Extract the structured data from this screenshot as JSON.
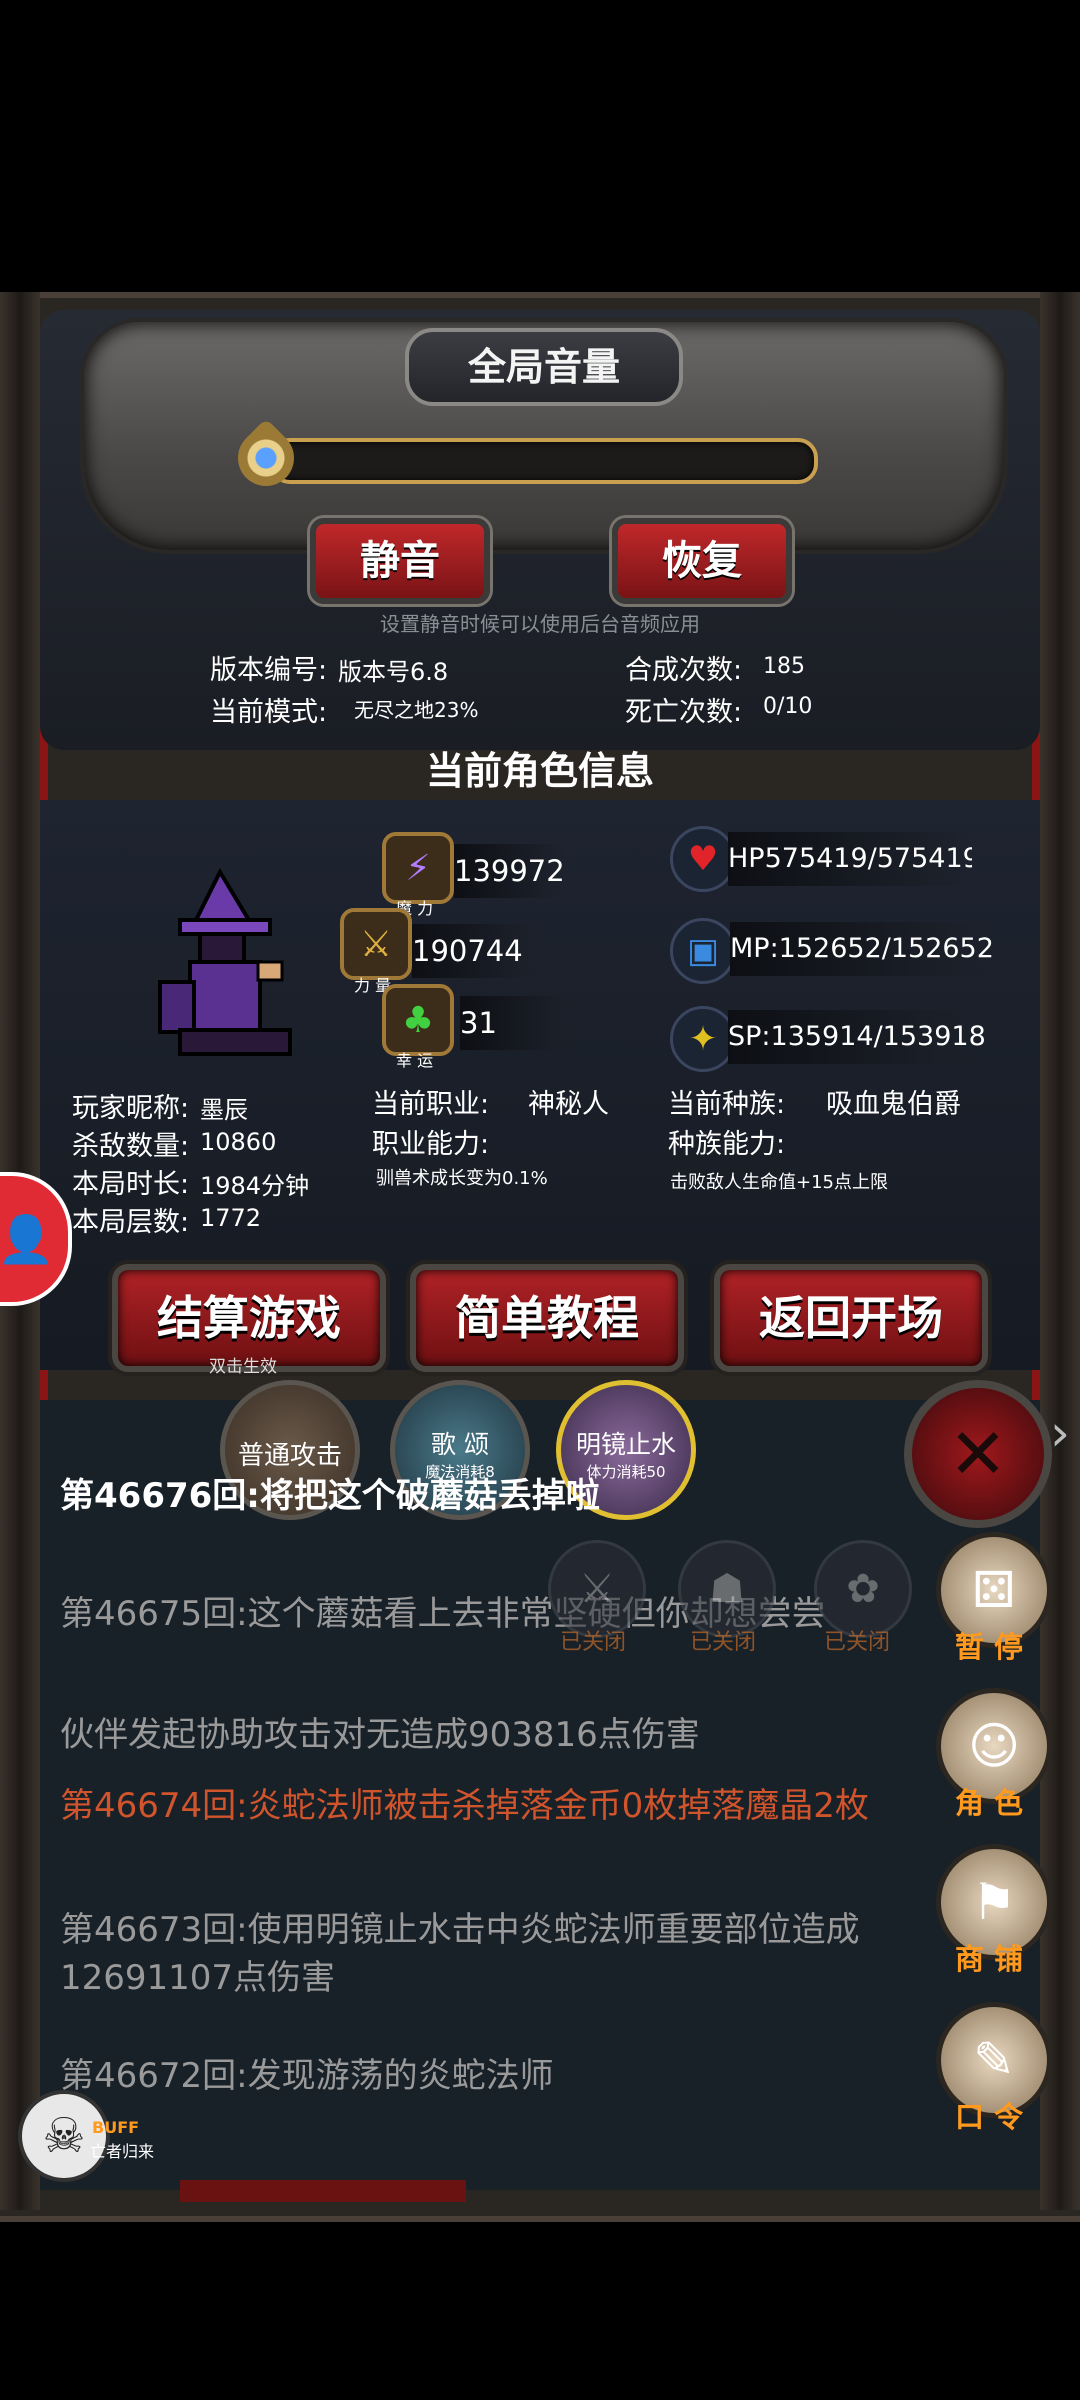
{
  "settings": {
    "title": "全局音量",
    "mute_label": "静音",
    "restore_label": "恢复",
    "hint": "设置静音时候可以使用后台音频应用",
    "version_label": "版本编号:",
    "version_value": "版本号6.8",
    "mode_label": "当前模式:",
    "mode_value": "无尽之地23%",
    "synth_label": "合成次数:",
    "synth_value": "185",
    "death_label": "死亡次数:",
    "death_value": "0/10",
    "volume_level": 0
  },
  "character": {
    "title": "当前角色信息",
    "magic_caption": "魔 力",
    "magic_value": "139972",
    "power_caption": "力 量",
    "power_value": "190744",
    "luck_caption": "幸 运",
    "luck_value": "31",
    "hp": "HP575419/575419",
    "mp": "MP:152652/152652",
    "sp": "SP:135914/153918",
    "nickname_label": "玩家昵称:",
    "nickname_value": "墨辰",
    "kills_label": "杀敌数量:",
    "kills_value": "10860",
    "time_label": "本局时长:",
    "time_value": "1984分钟",
    "floor_label": "本局层数:",
    "floor_value": "1772",
    "job_label": "当前职业:",
    "job_value": "神秘人",
    "job_ability_label": "职业能力:",
    "job_ability_value": "驯兽术成长变为0.1%",
    "race_label": "当前种族:",
    "race_value": "吸血鬼伯爵",
    "race_ability_label": "种族能力:",
    "race_ability_value": "击败敌人生命值+15点上限"
  },
  "actions": {
    "settle_label": "结算游戏",
    "settle_sub": "双击生效",
    "tutorial_label": "简单教程",
    "back_label": "返回开场"
  },
  "skills": [
    {
      "name": "普通攻击",
      "sub": ""
    },
    {
      "name": "歌 颂",
      "sub": "魔法消耗8"
    },
    {
      "name": "明镜止水",
      "sub": "体力消耗50"
    }
  ],
  "closed_label": "已关闭",
  "log": [
    {
      "text": "第46676回:将把这个破蘑菇丢掉啦",
      "color": "#ffffff"
    },
    {
      "text": "第46675回:这个蘑菇看上去非常坚硬但你却想尝尝",
      "color": "#9a9a9a"
    },
    {
      "text": "伙伴发起协助攻击对无造成903816点伤害",
      "color": "#9a9a9a"
    },
    {
      "text": "第46674回:炎蛇法师被击杀掉落金币0枚掉落魔晶2枚",
      "color": "#d0542c"
    },
    {
      "text": "第46673回:使用明镜止水击中炎蛇法师重要部位造成12691107点伤害",
      "color": "#9a9a9a"
    },
    {
      "text": "第46672回:发现游荡的炎蛇法师",
      "color": "#9a9a9a"
    }
  ],
  "right_menu": {
    "pause": "暂 停",
    "role": "角 色",
    "shop": "商 铺",
    "code": "口 令"
  },
  "buff": {
    "label": "BUFF",
    "name": "亡者归来"
  },
  "colors": {
    "accent_red": "#b02226",
    "orange": "#ff9a1e",
    "kill_log": "#d0542c"
  }
}
